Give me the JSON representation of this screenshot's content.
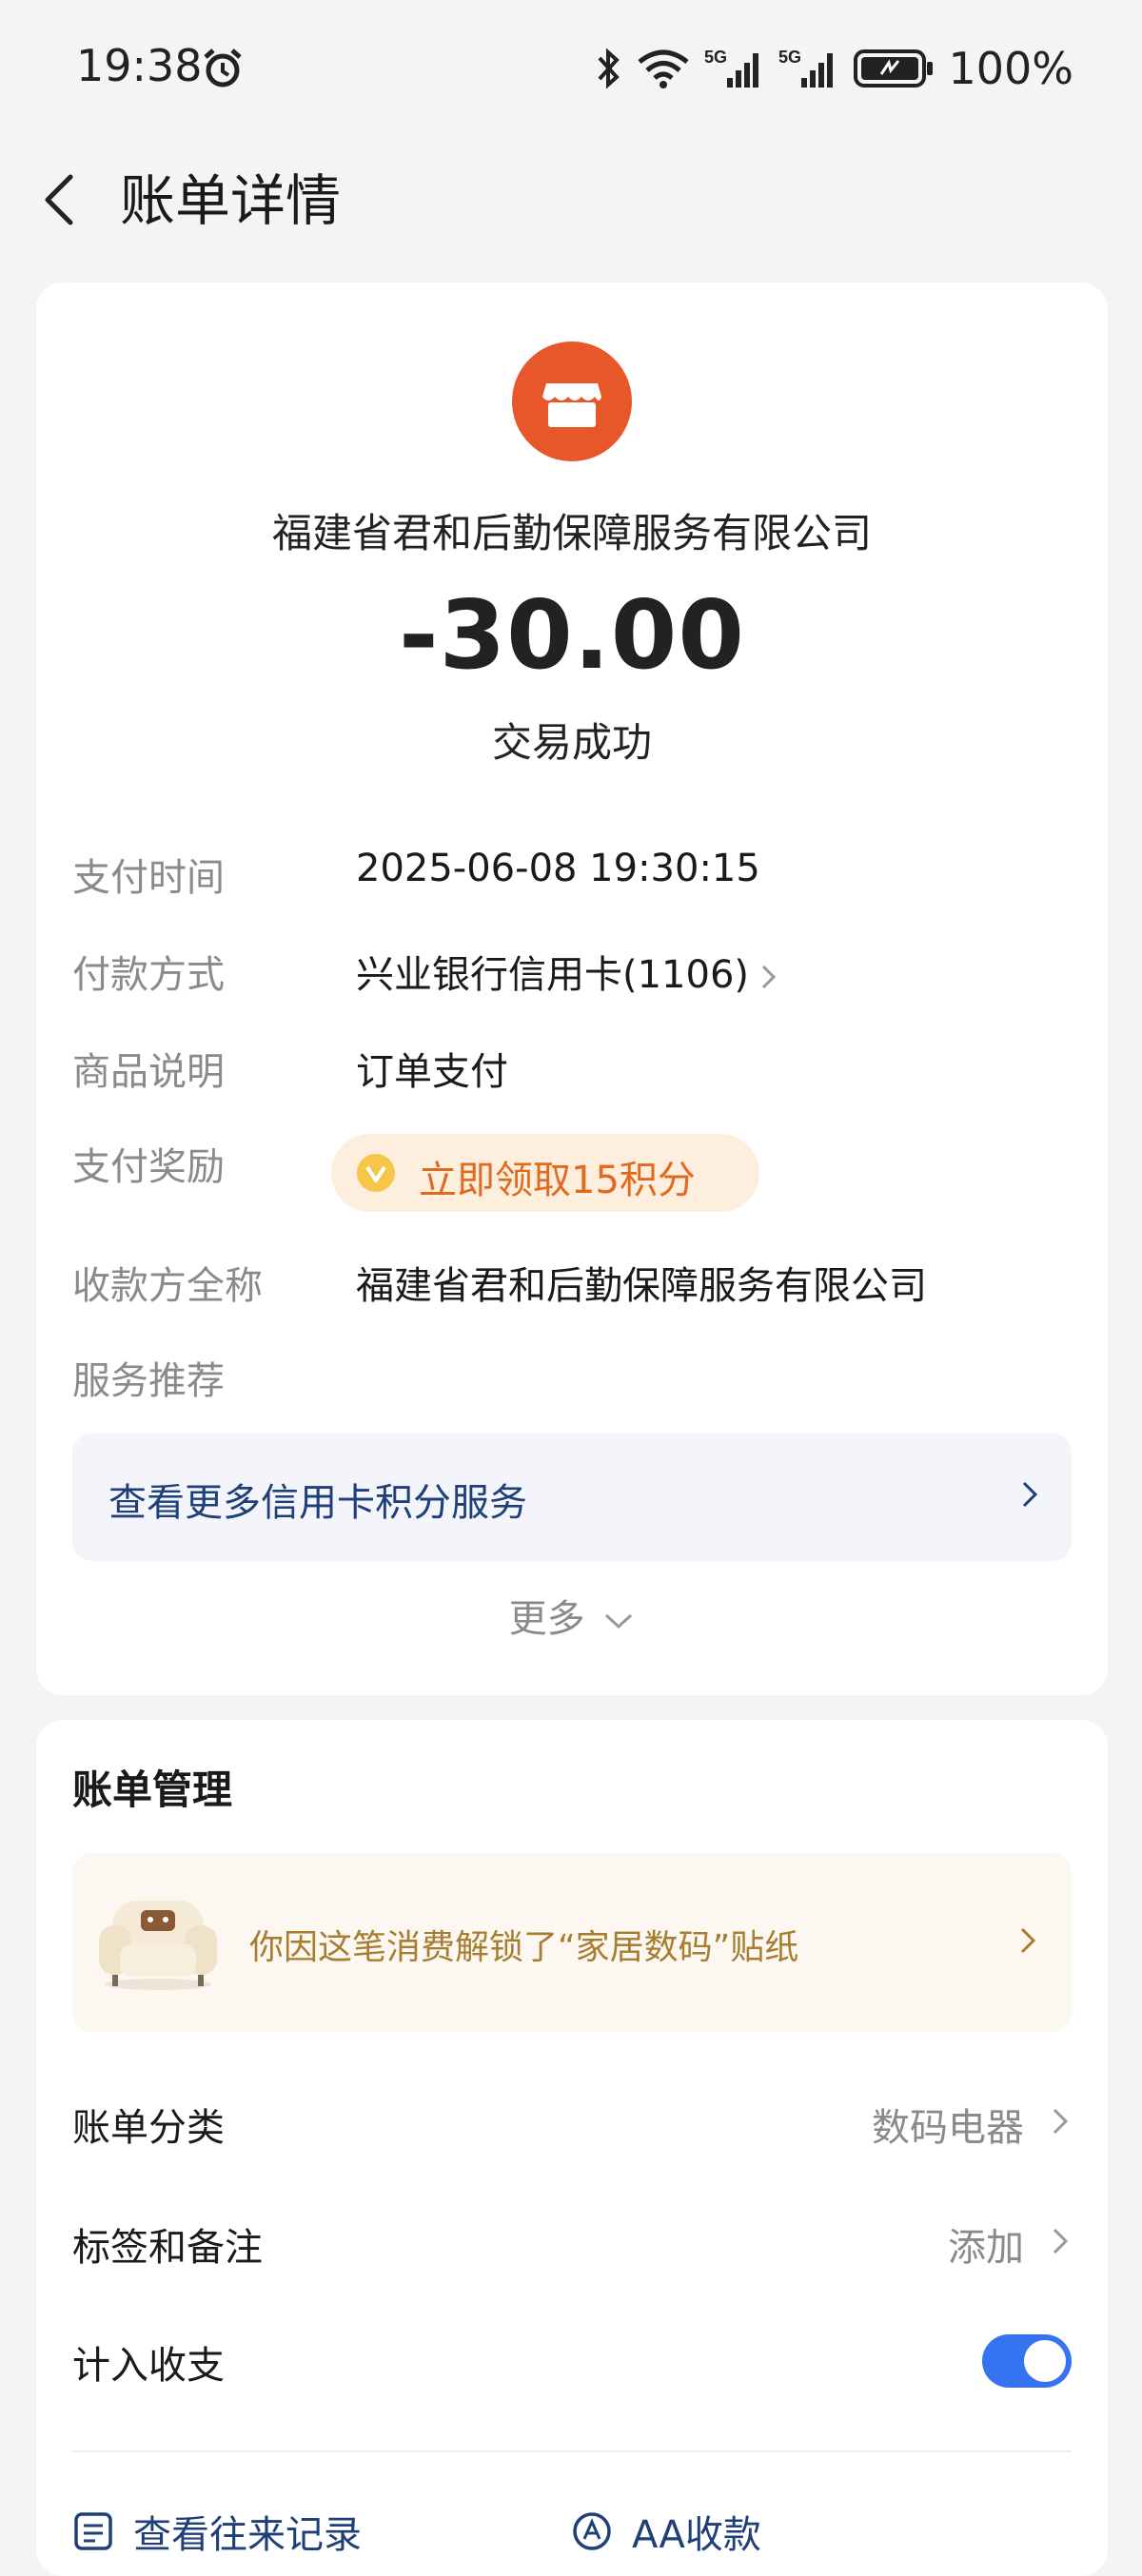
{
  "status_bar": {
    "time": "19:38",
    "battery": "100%",
    "icons": [
      "alarm-icon",
      "bluetooth-icon",
      "wifi-icon",
      "signal-5g-icon",
      "signal-5g-icon",
      "battery-icon"
    ]
  },
  "header": {
    "title": "账单详情"
  },
  "bill": {
    "merchant": "福建省君和后勤保障服务有限公司",
    "amount": "-30.00",
    "status": "交易成功",
    "rows": {
      "pay_time_label": "支付时间",
      "pay_time_value": "2025-06-08 19:30:15",
      "pay_method_label": "付款方式",
      "pay_method_value": "兴业银行信用卡(1106)",
      "goods_label": "商品说明",
      "goods_value": "订单支付",
      "reward_label": "支付奖励",
      "reward_value": "立即领取15积分",
      "payee_label": "收款方全称",
      "payee_value": "福建省君和后勤保障服务有限公司",
      "service_label": "服务推荐"
    },
    "promo": "查看更多信用卡积分服务",
    "more": "更多"
  },
  "management": {
    "title": "账单管理",
    "sticker": "你因这笔消费解锁了“家居数码”贴纸",
    "category_label": "账单分类",
    "category_value": "数码电器",
    "tags_label": "标签和备注",
    "tags_value": "添加",
    "count_label": "计入收支",
    "count_enabled": true,
    "links": {
      "history": "查看往来记录",
      "aa": "AA收款"
    }
  },
  "colors": {
    "accent_blue": "#3573f0",
    "merchant_orange": "#e8572a",
    "reward_orange": "#e06b1f",
    "promo_text": "#1f3f78"
  }
}
